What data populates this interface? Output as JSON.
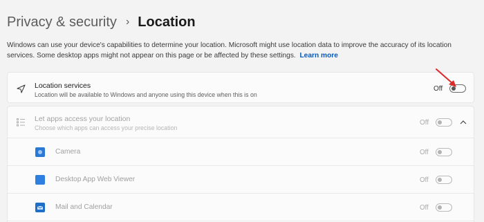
{
  "breadcrumb": {
    "parent": "Privacy & security",
    "separator": "›",
    "current": "Location"
  },
  "description": {
    "text": "Windows can use your device's capabilities to determine your location. Microsoft might use location data to improve the accuracy of its location services. Some desktop apps might not appear on this page or be affected by these settings.",
    "link": "Learn more"
  },
  "location_services": {
    "icon": "location-arrow-icon",
    "title": "Location services",
    "subtitle": "Location will be available to Windows and anyone using this device when this is on",
    "state": "Off"
  },
  "apps_access": {
    "icon": "list-icon",
    "title": "Let apps access your location",
    "subtitle": "Choose which apps can access your precise location",
    "state": "Off",
    "expand_icon": "chevron-up-icon"
  },
  "apps": [
    {
      "name": "Camera",
      "state": "Off",
      "icon": "camera-icon",
      "color": "#2b79d6"
    },
    {
      "name": "Desktop App Web Viewer",
      "state": "Off",
      "icon": "web-viewer-icon",
      "color": "#2f7fe0"
    },
    {
      "name": "Mail and Calendar",
      "state": "Off",
      "icon": "mail-icon",
      "color": "#1f6fc9"
    }
  ],
  "annotation_color": "#d92b2b"
}
